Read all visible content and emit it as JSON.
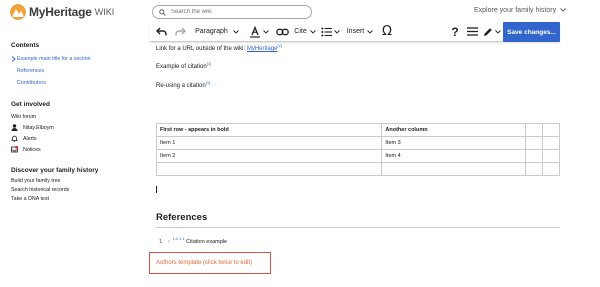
{
  "header": {
    "logo_text": "MyHeritage",
    "logo_suffix": "WIKI",
    "search_placeholder": "Search the wiki",
    "explore_label": "Explore your family history"
  },
  "toolbar": {
    "paragraph_label": "Paragraph",
    "cite_label": "Cite",
    "insert_label": "Insert",
    "save_label": "Save changes..."
  },
  "sidebar": {
    "contents_heading": "Contents",
    "contents_items": [
      "Example main title for a section",
      "References",
      "Contributors"
    ],
    "involved_heading": "Get involved",
    "wiki_forum": "Wiki forum",
    "user_name": "Nitay.Elboym",
    "alerts": "Alerts",
    "notices": "Notices",
    "discover_heading": "Discover your family history",
    "discover_items": [
      "Build your family tree",
      "Search historical records",
      "Take a DNA test"
    ]
  },
  "content": {
    "link_para_prefix": "Link for a URL outside of the wiki: ",
    "link_text": "MyHeritage",
    "link_sup": "[2]",
    "citation_example": "Example of citation",
    "citation_sup": "[1]",
    "reusing_citation": "Re-using a citation",
    "reusing_sup": "[1]"
  },
  "table": {
    "rows": [
      [
        "First row - appears in bold",
        "Another column",
        "",
        ""
      ],
      [
        "Item 1",
        "Item 3",
        "",
        ""
      ],
      [
        "Item 2",
        "Item 4",
        "",
        ""
      ],
      [
        "",
        "",
        "",
        ""
      ]
    ]
  },
  "references": {
    "heading": "References",
    "item_num": "1.",
    "item_up": "↑",
    "item_backlinks": "1.0 1.1",
    "item_text": "Citation example"
  },
  "authors_template": "Authors template (click twice to edit)",
  "colors": {
    "accent": "#3366cc",
    "save_button": "#3366cc",
    "authors_border": "#d9534f",
    "authors_text": "#e36a3c"
  }
}
